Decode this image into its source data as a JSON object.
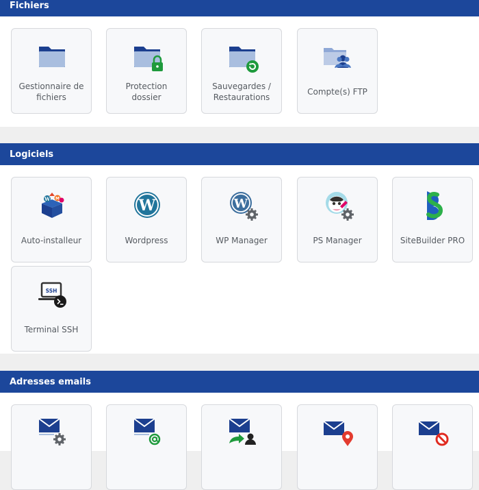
{
  "sections": [
    {
      "title": "Fichiers",
      "tiles": [
        {
          "label": "Gestionnaire de fichiers",
          "icon": "folder-icon"
        },
        {
          "label": "Protection dossier",
          "icon": "folder-lock-icon"
        },
        {
          "label": "Sauvegardes / Restaurations",
          "icon": "folder-restore-icon"
        },
        {
          "label": "Compte(s) FTP",
          "icon": "folder-users-icon"
        }
      ]
    },
    {
      "title": "Logiciels",
      "tiles": [
        {
          "label": "Auto-installeur",
          "icon": "cms-logos-icon"
        },
        {
          "label": "Wordpress",
          "icon": "wordpress-icon"
        },
        {
          "label": "WP Manager",
          "icon": "wordpress-gear-icon"
        },
        {
          "label": "PS Manager",
          "icon": "prestashop-gear-icon"
        },
        {
          "label": "SiteBuilder PRO",
          "icon": "sitebuilder-icon"
        },
        {
          "label": "Terminal SSH",
          "icon": "ssh-terminal-icon"
        }
      ]
    },
    {
      "title": "Adresses emails",
      "tiles": [
        {
          "label": "",
          "icon": "mail-gear-icon"
        },
        {
          "label": "",
          "icon": "mail-at-icon"
        },
        {
          "label": "",
          "icon": "mail-forward-icon"
        },
        {
          "label": "",
          "icon": "mail-location-icon"
        },
        {
          "label": "",
          "icon": "mail-block-icon"
        }
      ]
    }
  ],
  "colors": {
    "header": "#1c479b",
    "header_text": "#ffffff",
    "tile_bg": "#f7f8fa",
    "tile_border": "#d6d8dc",
    "label_text": "#555a60",
    "gap_bg": "#efefef"
  }
}
